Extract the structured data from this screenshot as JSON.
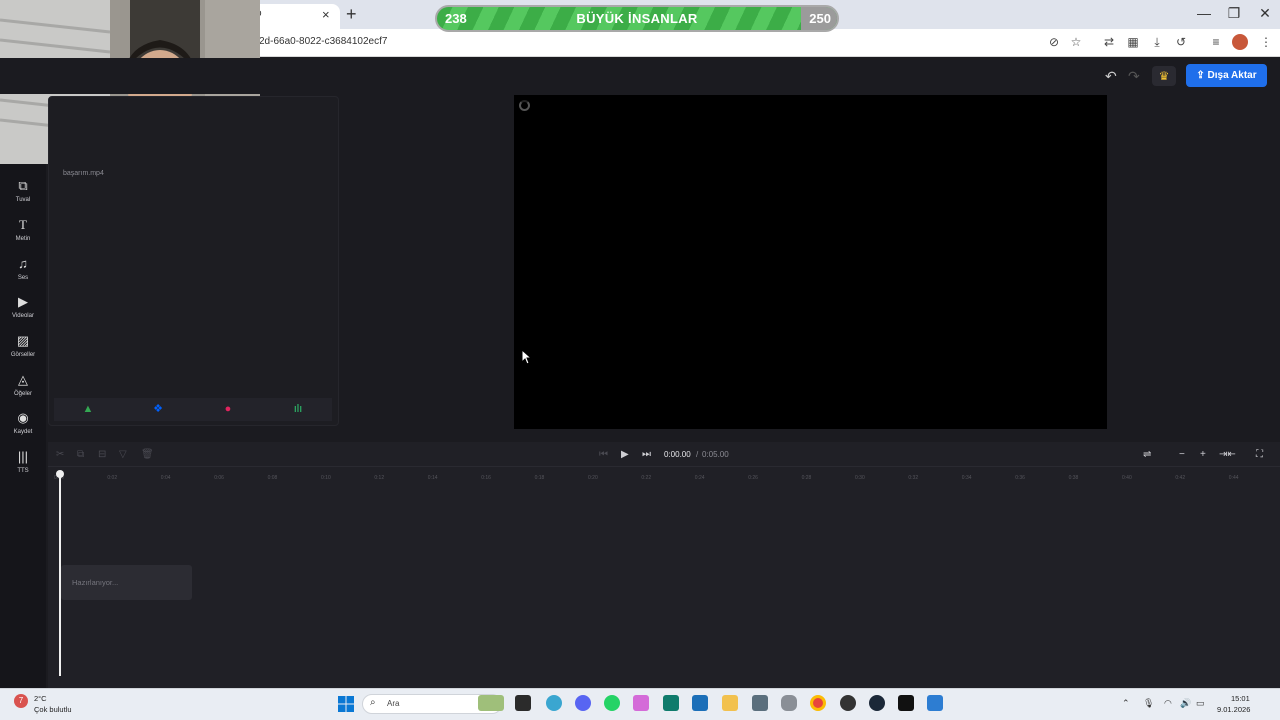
{
  "browser": {
    "url": "2d-66a0-8022-c3684102ecf7",
    "new_tab": "+",
    "tab_close": "×",
    "tab_fragment": "o",
    "window_controls": [
      "—",
      "❐",
      "✕"
    ]
  },
  "banner": {
    "left_count": "238",
    "title": "BÜYÜK İNSANLAR",
    "right_count": "250"
  },
  "app": {
    "export_label": "Dışa Aktar",
    "sidebar": [
      {
        "label": "Tuval",
        "icon": "canvas-icon"
      },
      {
        "label": "Metin",
        "icon": "text-icon"
      },
      {
        "label": "Ses",
        "icon": "music-icon"
      },
      {
        "label": "Videolar",
        "icon": "video-icon"
      },
      {
        "label": "Görseller",
        "icon": "image-icon"
      },
      {
        "label": "Öğeler",
        "icon": "shapes-icon"
      },
      {
        "label": "Kaydet",
        "icon": "record-icon"
      },
      {
        "label": "TTS",
        "icon": "tts-icon"
      }
    ],
    "media": {
      "file_name": "başarım.mp4"
    },
    "timeline": {
      "current_time": "0:00.00",
      "separator": "/",
      "total_time": "0:05.00",
      "clip_label": "Hazırlanıyor...",
      "ticks": [
        "0:00",
        "0:02",
        "0:04",
        "0:06",
        "0:08",
        "0:10",
        "0:12",
        "0:14",
        "0:16",
        "0:18",
        "0:20",
        "0:22",
        "0:24",
        "0:26",
        "0:28",
        "0:30",
        "0:32",
        "0:34",
        "0:36",
        "0:38",
        "0:40",
        "0:42",
        "0:44"
      ]
    }
  },
  "taskbar": {
    "weather_temp": "2°C",
    "weather_desc": "Çok bulutlu",
    "weather_badge": "7",
    "search_label": "Ara",
    "time": "15:01",
    "date": "9.01.2026"
  }
}
